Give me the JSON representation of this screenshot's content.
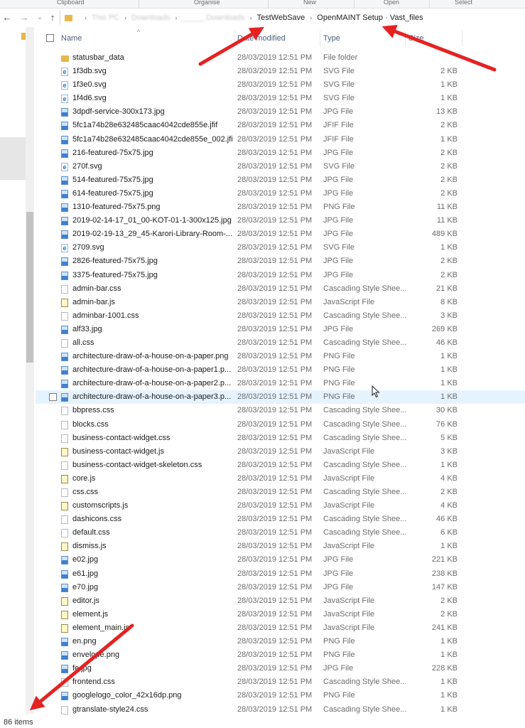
{
  "ribbon": {
    "groups": [
      "Clipboard",
      "Organise",
      "New",
      "Open",
      "Select"
    ]
  },
  "nav": {
    "back": "←",
    "forward": "→",
    "recent": "⌄",
    "up": "↑",
    "breadcrumbs": [
      {
        "label": "This PC",
        "blurred": true
      },
      {
        "label": "Downloads",
        "blurred": true
      },
      {
        "label": "_____ Downloads",
        "blurred": true
      },
      {
        "label": "TestWebSave",
        "blurred": false
      },
      {
        "label": "OpenMAINT Setup · Vast_files",
        "blurred": false
      }
    ]
  },
  "columns": {
    "name": "Name",
    "date": "Date modified",
    "type": "Type",
    "size": "Size"
  },
  "files": [
    {
      "name": "statusbar_data",
      "date": "28/03/2019 12:51 PM",
      "type": "File folder",
      "size": "",
      "icon": "folder"
    },
    {
      "name": "1f3db.svg",
      "date": "28/03/2019 12:51 PM",
      "type": "SVG File",
      "size": "2 KB",
      "icon": "svg"
    },
    {
      "name": "1f3e0.svg",
      "date": "28/03/2019 12:51 PM",
      "type": "SVG File",
      "size": "1 KB",
      "icon": "svg"
    },
    {
      "name": "1f4d6.svg",
      "date": "28/03/2019 12:51 PM",
      "type": "SVG File",
      "size": "1 KB",
      "icon": "svg"
    },
    {
      "name": "3dpdf-service-300x173.jpg",
      "date": "28/03/2019 12:51 PM",
      "type": "JPG File",
      "size": "13 KB",
      "icon": "img"
    },
    {
      "name": "5fc1a74b28e632485caac4042cde855e.jfif",
      "date": "28/03/2019 12:51 PM",
      "type": "JFIF File",
      "size": "2 KB",
      "icon": "img"
    },
    {
      "name": "5fc1a74b28e632485caac4042cde855e_002.jfif",
      "date": "28/03/2019 12:51 PM",
      "type": "JFIF File",
      "size": "1 KB",
      "icon": "img"
    },
    {
      "name": "216-featured-75x75.jpg",
      "date": "28/03/2019 12:51 PM",
      "type": "JPG File",
      "size": "2 KB",
      "icon": "img"
    },
    {
      "name": "270f.svg",
      "date": "28/03/2019 12:51 PM",
      "type": "SVG File",
      "size": "2 KB",
      "icon": "svg"
    },
    {
      "name": "514-featured-75x75.jpg",
      "date": "28/03/2019 12:51 PM",
      "type": "JPG File",
      "size": "2 KB",
      "icon": "img"
    },
    {
      "name": "614-featured-75x75.jpg",
      "date": "28/03/2019 12:51 PM",
      "type": "JPG File",
      "size": "2 KB",
      "icon": "img"
    },
    {
      "name": "1310-featured-75x75.png",
      "date": "28/03/2019 12:51 PM",
      "type": "PNG File",
      "size": "11 KB",
      "icon": "img"
    },
    {
      "name": "2019-02-14-17_01_00-KOT-01-1-300x125.jpg",
      "date": "28/03/2019 12:51 PM",
      "type": "JPG File",
      "size": "11 KB",
      "icon": "img"
    },
    {
      "name": "2019-02-19-13_29_45-Karori-Library-Room-...",
      "date": "28/03/2019 12:51 PM",
      "type": "JPG File",
      "size": "489 KB",
      "icon": "img"
    },
    {
      "name": "2709.svg",
      "date": "28/03/2019 12:51 PM",
      "type": "SVG File",
      "size": "1 KB",
      "icon": "svg"
    },
    {
      "name": "2826-featured-75x75.jpg",
      "date": "28/03/2019 12:51 PM",
      "type": "JPG File",
      "size": "2 KB",
      "icon": "img"
    },
    {
      "name": "3375-featured-75x75.jpg",
      "date": "28/03/2019 12:51 PM",
      "type": "JPG File",
      "size": "2 KB",
      "icon": "img"
    },
    {
      "name": "admin-bar.css",
      "date": "28/03/2019 12:51 PM",
      "type": "Cascading Style Shee...",
      "size": "21 KB",
      "icon": "css"
    },
    {
      "name": "admin-bar.js",
      "date": "28/03/2019 12:51 PM",
      "type": "JavaScript File",
      "size": "8 KB",
      "icon": "js"
    },
    {
      "name": "adminbar-1001.css",
      "date": "28/03/2019 12:51 PM",
      "type": "Cascading Style Shee...",
      "size": "3 KB",
      "icon": "css"
    },
    {
      "name": "alf33.jpg",
      "date": "28/03/2019 12:51 PM",
      "type": "JPG File",
      "size": "269 KB",
      "icon": "img"
    },
    {
      "name": "all.css",
      "date": "28/03/2019 12:51 PM",
      "type": "Cascading Style Shee...",
      "size": "46 KB",
      "icon": "css"
    },
    {
      "name": "architecture-draw-of-a-house-on-a-paper.png",
      "date": "28/03/2019 12:51 PM",
      "type": "PNG File",
      "size": "1 KB",
      "icon": "img"
    },
    {
      "name": "architecture-draw-of-a-house-on-a-paper1.p...",
      "date": "28/03/2019 12:51 PM",
      "type": "PNG File",
      "size": "1 KB",
      "icon": "img"
    },
    {
      "name": "architecture-draw-of-a-house-on-a-paper2.p...",
      "date": "28/03/2019 12:51 PM",
      "type": "PNG File",
      "size": "1 KB",
      "icon": "img"
    },
    {
      "name": "architecture-draw-of-a-house-on-a-paper3.p...",
      "date": "28/03/2019 12:51 PM",
      "type": "PNG File",
      "size": "1 KB",
      "icon": "img",
      "hover": true
    },
    {
      "name": "bbpress.css",
      "date": "28/03/2019 12:51 PM",
      "type": "Cascading Style Shee...",
      "size": "30 KB",
      "icon": "css"
    },
    {
      "name": "blocks.css",
      "date": "28/03/2019 12:51 PM",
      "type": "Cascading Style Shee...",
      "size": "76 KB",
      "icon": "css"
    },
    {
      "name": "business-contact-widget.css",
      "date": "28/03/2019 12:51 PM",
      "type": "Cascading Style Shee...",
      "size": "5 KB",
      "icon": "css"
    },
    {
      "name": "business-contact-widget.js",
      "date": "28/03/2019 12:51 PM",
      "type": "JavaScript File",
      "size": "3 KB",
      "icon": "js"
    },
    {
      "name": "business-contact-widget-skeleton.css",
      "date": "28/03/2019 12:51 PM",
      "type": "Cascading Style Shee...",
      "size": "1 KB",
      "icon": "css"
    },
    {
      "name": "core.js",
      "date": "28/03/2019 12:51 PM",
      "type": "JavaScript File",
      "size": "4 KB",
      "icon": "js"
    },
    {
      "name": "css.css",
      "date": "28/03/2019 12:51 PM",
      "type": "Cascading Style Shee...",
      "size": "2 KB",
      "icon": "css"
    },
    {
      "name": "customscripts.js",
      "date": "28/03/2019 12:51 PM",
      "type": "JavaScript File",
      "size": "4 KB",
      "icon": "js"
    },
    {
      "name": "dashicons.css",
      "date": "28/03/2019 12:51 PM",
      "type": "Cascading Style Shee...",
      "size": "46 KB",
      "icon": "css"
    },
    {
      "name": "default.css",
      "date": "28/03/2019 12:51 PM",
      "type": "Cascading Style Shee...",
      "size": "6 KB",
      "icon": "css"
    },
    {
      "name": "dismiss.js",
      "date": "28/03/2019 12:51 PM",
      "type": "JavaScript File",
      "size": "1 KB",
      "icon": "js"
    },
    {
      "name": "e02.jpg",
      "date": "28/03/2019 12:51 PM",
      "type": "JPG File",
      "size": "221 KB",
      "icon": "img"
    },
    {
      "name": "e61.jpg",
      "date": "28/03/2019 12:51 PM",
      "type": "JPG File",
      "size": "238 KB",
      "icon": "img"
    },
    {
      "name": "e70.jpg",
      "date": "28/03/2019 12:51 PM",
      "type": "JPG File",
      "size": "147 KB",
      "icon": "img"
    },
    {
      "name": "editor.js",
      "date": "28/03/2019 12:51 PM",
      "type": "JavaScript File",
      "size": "2 KB",
      "icon": "js"
    },
    {
      "name": "element.js",
      "date": "28/03/2019 12:51 PM",
      "type": "JavaScript File",
      "size": "2 KB",
      "icon": "js"
    },
    {
      "name": "element_main.js",
      "date": "28/03/2019 12:51 PM",
      "type": "JavaScript File",
      "size": "241 KB",
      "icon": "js"
    },
    {
      "name": "en.png",
      "date": "28/03/2019 12:51 PM",
      "type": "PNG File",
      "size": "1 KB",
      "icon": "img"
    },
    {
      "name": "envelope.png",
      "date": "28/03/2019 12:51 PM",
      "type": "PNG File",
      "size": "1 KB",
      "icon": "img"
    },
    {
      "name": "fe.jpg",
      "date": "28/03/2019 12:51 PM",
      "type": "JPG File",
      "size": "228 KB",
      "icon": "img"
    },
    {
      "name": "frontend.css",
      "date": "28/03/2019 12:51 PM",
      "type": "Cascading Style Shee...",
      "size": "1 KB",
      "icon": "css"
    },
    {
      "name": "googlelogo_color_42x16dp.png",
      "date": "28/03/2019 12:51 PM",
      "type": "PNG File",
      "size": "1 KB",
      "icon": "img"
    },
    {
      "name": "gtranslate-style24.css",
      "date": "28/03/2019 12:51 PM",
      "type": "Cascading Style Shee...",
      "size": "1 KB",
      "icon": "css"
    }
  ],
  "status": {
    "item_count": "86 items"
  },
  "colors": {
    "hover_row": "#e5f3ff",
    "annotation_arrow": "#e52222",
    "header_text": "#4c607a"
  },
  "annotations": [
    "red-arrow-breadcrumb-testwebsave",
    "red-arrow-breadcrumb-vast-files",
    "red-arrow-item-count"
  ]
}
